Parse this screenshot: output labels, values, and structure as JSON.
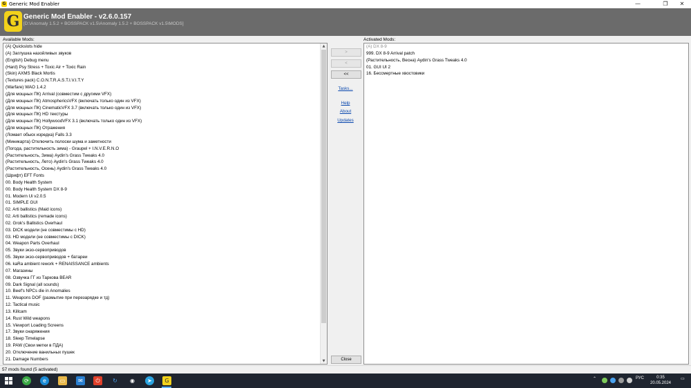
{
  "window": {
    "title": "Generic Mod Enabler",
    "controls": {
      "minimize": "—",
      "maximize": "❐",
      "close": "✕"
    }
  },
  "header": {
    "logo_letter": "G",
    "title": "Generic Mod Enabler - v2.6.0.157",
    "path": "[D:\\Anomaly 1.5.2 + BOSSPACK v1.5\\Anomaly 1.5.2 + BOSSPACK v1.5\\MODS]"
  },
  "available": {
    "label": "Available Mods:",
    "items": [
      "(A) Quickslots hide",
      "(A) Заглушка назойливых звуков",
      "(English) Debug menu",
      "(Hard) Psy Stress + Toxic Air + Toxic Rain",
      "(Skin) AXMS Black Mortis",
      "(Textures pack) C.O.N.T.R.A.S.T.I.V.I.T.Y",
      "(Warfare) WAO 1.4.2",
      "(Для мощных ПК) Arrival (совместим с другими VFX)",
      "(Для мощных ПК) AtmosphericsVFX (включать только один из VFX)",
      "(Для мощных ПК) CinematicVFX 3.7 (включать только один из VFX)",
      "(Для мощных ПК) HD текстуры",
      "(Для мощных ПК) HollywoodVFX 3.1 (включать только один из VFX)",
      "(Для мощных ПК) Отражения",
      "(Ломает обыск изредка) Falls 3.3",
      "(Миникарта) Отключить полоски шума и заметности",
      "(Погода, растительность зима) - Graupel + I.N.V.E.R.N.O",
      "(Растительность, Зима) Aydin's Grass Tweaks 4.0",
      "(Растительность, Лето) Aydin's Grass Tweaks 4.0",
      "(Растительность, Осень) Aydin's Grass Tweaks 4.0",
      "(Шрифт) EFT Fonts",
      "00. Body Health System",
      "00. Body Health System DX 8-9",
      "01. Modern Ui v2.0.5",
      "01. SIMPLE GUI",
      "02. Arti ballistics (Maid icons)",
      "02. Arti ballistics (remade icons)",
      "02. Grok's Ballistics Overhaul",
      "03. DICK модели (не совместимы с HD)",
      "03. HD модели (не совместимы с DICK)",
      "04. Weapon Parts Overhaul",
      "05. Звуки экзо-сервоприводов",
      "05. Звуки экзо-сервоприводов + батареи",
      "06. kaRa ambient rework + RENAISSANCE ambients",
      "07. Магазины",
      "08. Озвучка ГГ из Таркова BEAR",
      "09. Dark Signal (all sounds)",
      "10. Beef's NPCs die in Anomalies",
      "11. Weapons DOF (размытие при перезарядке и тд)",
      "12. Tactical music",
      "13. Killcam",
      "14. Rust Wild weapons",
      "15. Viewport Loading Screens",
      "17. Звуки снаряжения",
      "18. Sleep Timelapse",
      "19. PAW (Свои метки в ПДА)",
      "20. Отключение ванильных пушек",
      "21. Damage Numbers"
    ]
  },
  "activated": {
    "label": "Activated Mods:",
    "items": [
      {
        "text": "(A) DX 8-9",
        "dim": true
      },
      {
        "text": "999. DX 8-9 Arrival patch",
        "dim": false
      },
      {
        "text": "(Растительность, Весна) Aydin's Grass Tweaks 4.0",
        "dim": false
      },
      {
        "text": "01. GUI UI 2",
        "dim": false
      },
      {
        "text": "16. Бессмертные хвостовики",
        "dim": false
      }
    ]
  },
  "buttons": {
    "add": ">",
    "remove": "<",
    "remove_all": "<<",
    "close": "Close"
  },
  "links": {
    "tasks": "Tasks...",
    "help": "Help",
    "about": "About",
    "updates": "Updates"
  },
  "status": {
    "text": "57 mods found (5 activated)"
  },
  "taskbar": {
    "language": "РУС",
    "time": "0:35",
    "date": "20.05.2024"
  }
}
